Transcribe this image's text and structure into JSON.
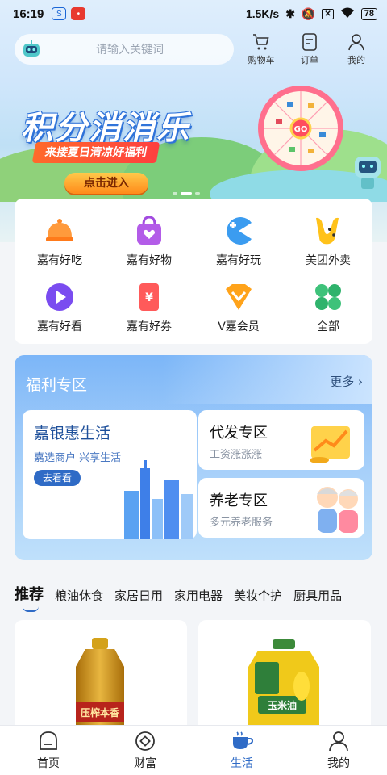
{
  "status_bar": {
    "time": "16:19",
    "network_speed": "1.5K/s",
    "battery": "78"
  },
  "header": {
    "search_placeholder": "请输入关键词",
    "nav": [
      {
        "label": "购物车",
        "icon": "cart-icon"
      },
      {
        "label": "订单",
        "icon": "order-icon"
      },
      {
        "label": "我的",
        "icon": "user-icon"
      }
    ]
  },
  "banner": {
    "title": "积分消消乐",
    "subtitle": "来接夏日清凉好福利",
    "button": "点击进入",
    "wheel_label": "GO"
  },
  "services": [
    {
      "label": "嘉有好吃",
      "icon": "food-cloche-icon"
    },
    {
      "label": "嘉有好物",
      "icon": "shopping-bag-icon"
    },
    {
      "label": "嘉有好玩",
      "icon": "game-icon"
    },
    {
      "label": "美团外卖",
      "icon": "meituan-icon"
    },
    {
      "label": "嘉有好看",
      "icon": "play-icon"
    },
    {
      "label": "嘉有好券",
      "icon": "coupon-icon"
    },
    {
      "label": "V嘉会员",
      "icon": "vip-icon"
    },
    {
      "label": "全部",
      "icon": "all-icon"
    }
  ],
  "welfare": {
    "title": "福利专区",
    "more": "更多",
    "main_card": {
      "title": "嘉银惠生活",
      "subtitle": "嘉选商户 兴享生活",
      "button": "去看看"
    },
    "cards": [
      {
        "title": "代发专区",
        "subtitle": "工资涨涨涨"
      },
      {
        "title": "养老专区",
        "subtitle": "多元养老服务"
      }
    ]
  },
  "categories": {
    "active": "推荐",
    "items": [
      "粮油休食",
      "家居日用",
      "家用电器",
      "美妆个护",
      "厨具用品"
    ]
  },
  "products": [
    {
      "name": "oil-bottle-1",
      "label": "压榨本香"
    },
    {
      "name": "oil-bottle-2",
      "label": "玉米油"
    }
  ],
  "bottom_nav": [
    {
      "label": "首页",
      "icon": "home-icon"
    },
    {
      "label": "财富",
      "icon": "wealth-icon"
    },
    {
      "label": "生活",
      "icon": "coffee-icon"
    },
    {
      "label": "我的",
      "icon": "profile-icon"
    }
  ],
  "colors": {
    "accent": "#2f6bc6",
    "banner_button": "#ff8a1a",
    "welfare_bg": "#8fc0f8"
  }
}
